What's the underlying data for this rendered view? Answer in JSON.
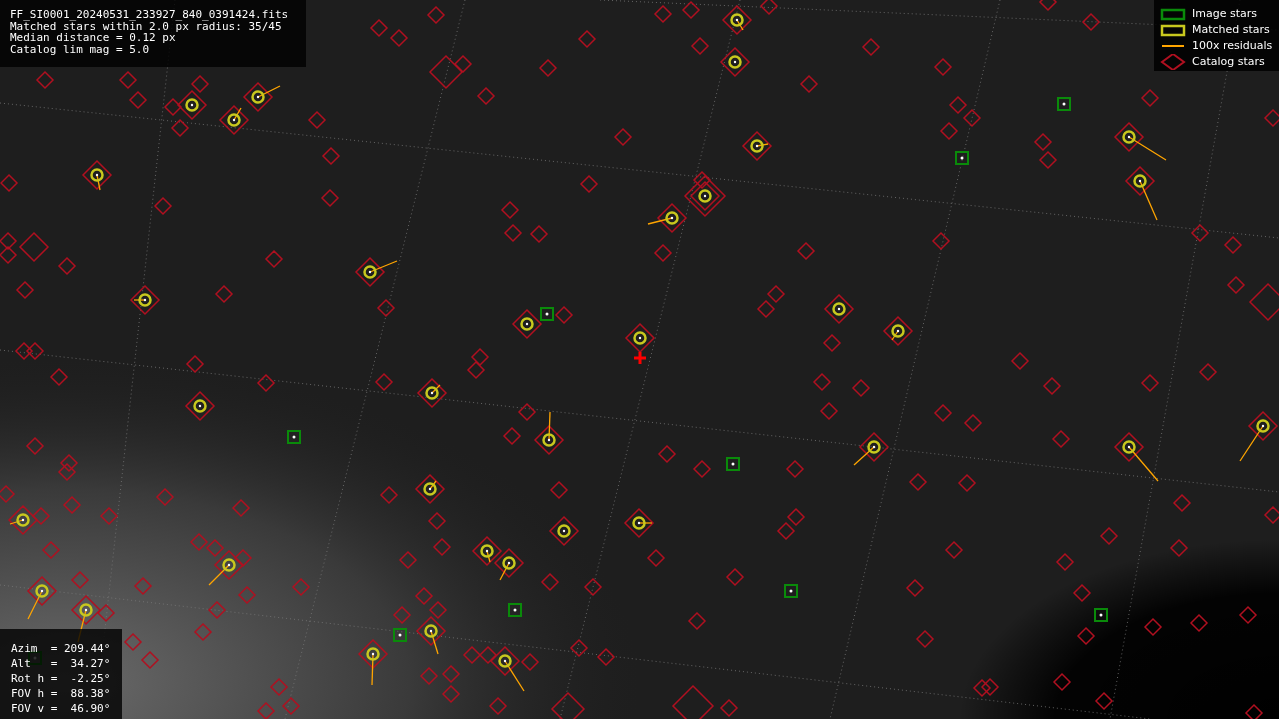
{
  "info_box": {
    "lines": [
      "FF_SI0001_20240531_233927_840_0391424.fits",
      "Matched stars within 2.0 px radius: 35/45",
      "Median distance = 0.12 px",
      "Catalog lim mag = 5.0"
    ]
  },
  "legend": [
    {
      "kind": "square",
      "label": "Image stars",
      "color": "#0a8a0a"
    },
    {
      "kind": "square",
      "label": "Matched stars",
      "color": "#c8c81e"
    },
    {
      "kind": "line",
      "label": "100x residuals",
      "color": "#ffa500"
    },
    {
      "kind": "diamond",
      "label": "Catalog stars",
      "color": "#b01020"
    }
  ],
  "pointing": [
    "Azim  = 209.44°",
    "Alt   =  34.27°",
    "Rot h =  -2.25°",
    "FOV h =  88.38°",
    "FOV v =  46.90°"
  ]
}
